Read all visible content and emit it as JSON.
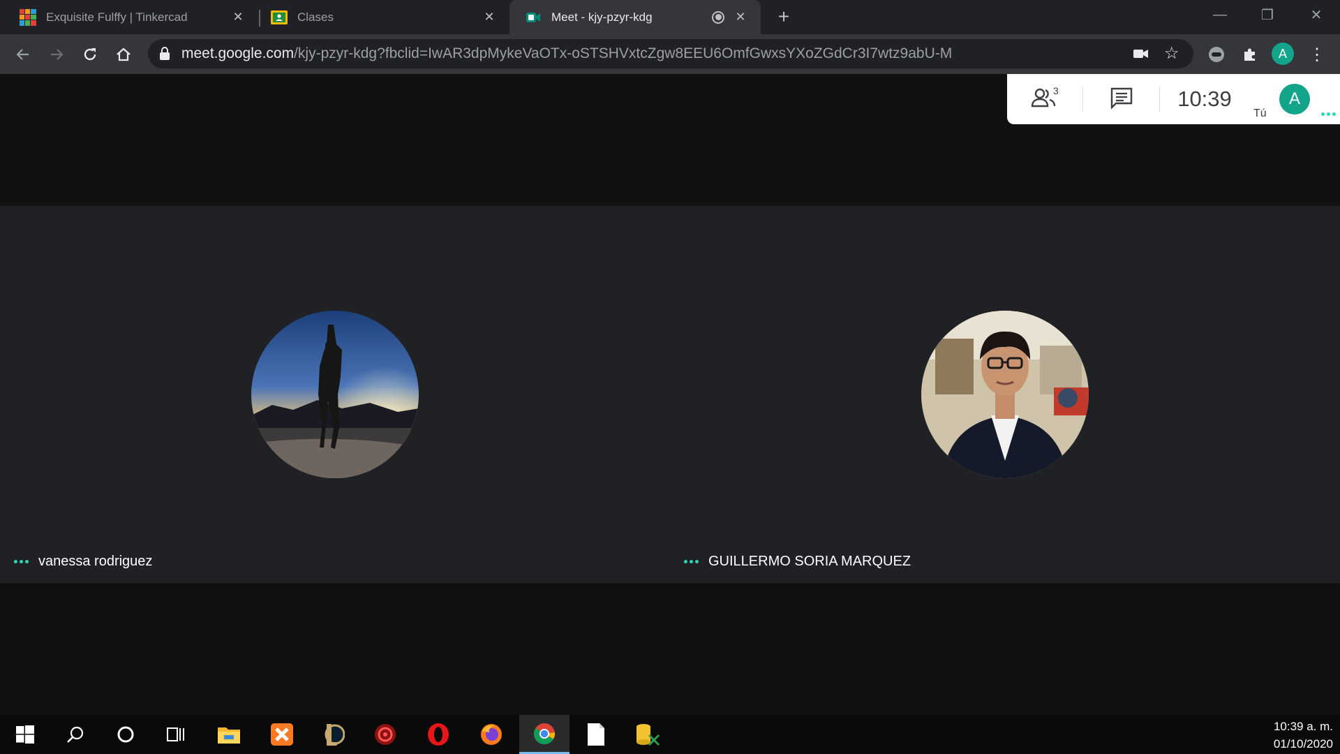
{
  "browser": {
    "tabs": [
      {
        "title": "Exquisite Fulffy | Tinkercad",
        "icon": "tinkercad-icon",
        "active": false
      },
      {
        "title": "Clases",
        "icon": "google-classroom-icon",
        "active": false
      },
      {
        "title": "Meet - kjy-pzyr-kdg",
        "icon": "google-meet-icon",
        "active": true
      }
    ],
    "new_tab_icon": "plus-icon",
    "url": {
      "host": "meet.google.com",
      "path": "/kjy-pzyr-kdg?fbclid=IwAR3dpMykeVaOTx-oSTSHVxtcZgw8EEU6OmfGwxsYXoZGdCr3I7wtz9abU-M"
    },
    "profile_initial": "A"
  },
  "meet": {
    "participant_count": "3",
    "time": "10:39",
    "you_label": "Tú",
    "user_initial": "A",
    "participants": [
      {
        "name": "vanessa rodriguez",
        "avatar": "sunset-silhouette-photo"
      },
      {
        "name": "GUILLERMO SORIA MARQUEZ",
        "avatar": "young-man-glasses-photo"
      }
    ]
  },
  "taskbar": {
    "apps": [
      "windows-start-icon",
      "search-icon",
      "cortana-icon",
      "task-view-icon",
      "file-explorer-icon",
      "xampp-icon",
      "league-of-legends-icon",
      "app-red-gear-icon",
      "opera-icon",
      "firefox-icon",
      "chrome-icon",
      "notepad-file-icon",
      "database-tool-icon"
    ],
    "time": "10:39 a. m.",
    "date": "01/10/2020"
  },
  "colors": {
    "accent_teal": "#12a58b",
    "dots_teal": "#2fd5b6",
    "tile_bg": "#202124",
    "page_bg": "#111111"
  }
}
